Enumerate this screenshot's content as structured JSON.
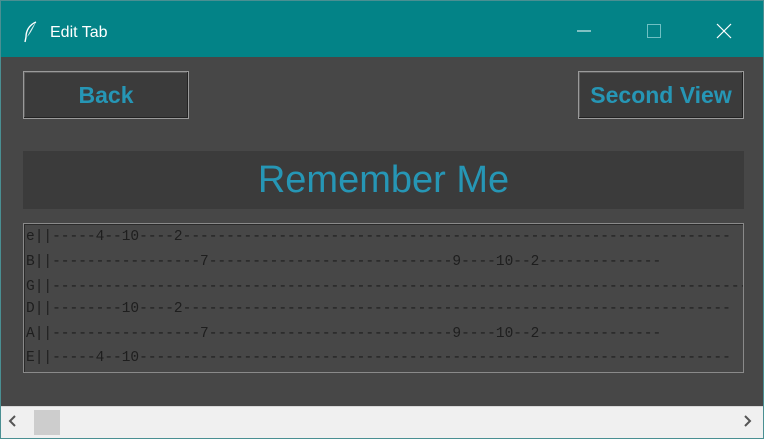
{
  "window": {
    "title": "Edit Tab",
    "app_icon": "feather-icon",
    "controls": [
      "minimize-icon",
      "maximize-icon",
      "close-icon"
    ]
  },
  "buttons": {
    "back_label": "Back",
    "second_view_label": "Second View"
  },
  "song": {
    "title": "Remember Me"
  },
  "tab": {
    "lines": [
      "e||-----4--10----2---------------------------------------------------------------",
      "B||-----------------7----------------------------9----10--2--------------",
      "G||----------------------------------------------------------------------------------",
      "D||--------10----2---------------------------------------------------------------",
      "A||-----------------7----------------------------9----10--2--------------",
      "E||-----4--10--------------------------------------------------------------------"
    ]
  },
  "scrollbar": {
    "left_arrow": "chevron-left-icon",
    "right_arrow": "chevron-right-icon"
  },
  "colors": {
    "titlebar": "#038387",
    "background": "#474747",
    "accent_text": "#2696b5"
  }
}
